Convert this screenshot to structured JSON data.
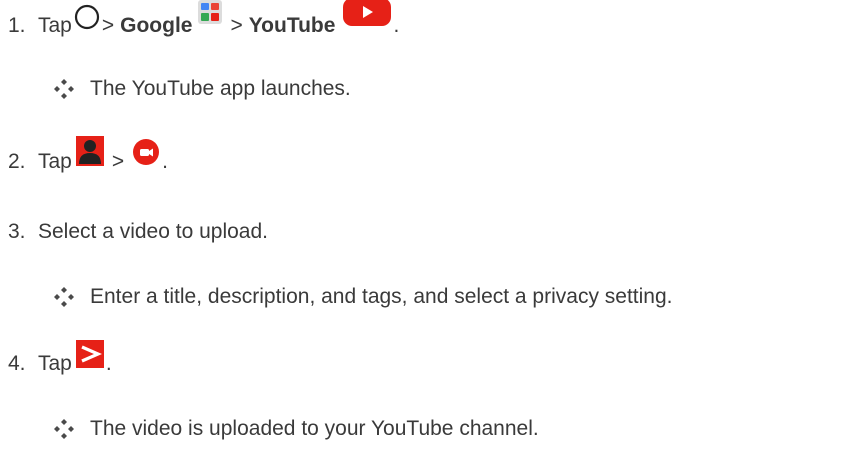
{
  "steps": [
    {
      "num": "1.",
      "tap": "Tap",
      "sep1": ">",
      "google": "Google",
      "sep2": ">",
      "youtube": "YouTube",
      "end": "."
    },
    {
      "num": "2.",
      "tap": "Tap",
      "sep1": ">",
      "end": "."
    },
    {
      "num": "3.",
      "text": "Select a video to upload."
    },
    {
      "num": "4.",
      "tap": "Tap",
      "end": "."
    }
  ],
  "results": [
    "The YouTube app launches.",
    "Enter a title, description, and tags, and select a privacy setting.",
    "The video is uploaded to your YouTube channel."
  ],
  "icons": {
    "home": "home-circle-icon",
    "google_folder": "google-folder-icon",
    "youtube": "youtube-app-icon",
    "account": "account-icon",
    "record": "record-video-icon",
    "send": "send-upload-icon",
    "bullet": "diamond-bullet-icon"
  },
  "colors": {
    "text": "#3a3a3a",
    "youtube_red": "#e62117",
    "bullet": "#4a4a4a"
  }
}
